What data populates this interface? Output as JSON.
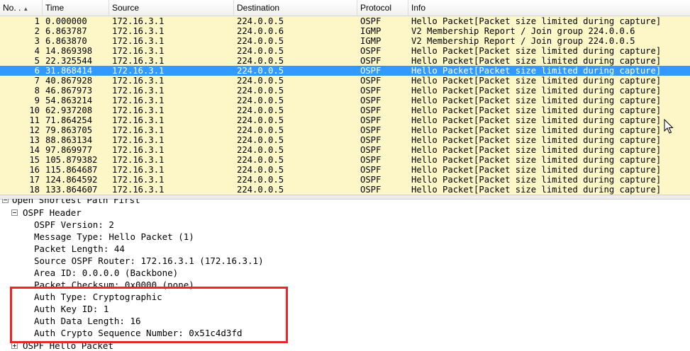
{
  "columns": [
    {
      "key": "no",
      "label": "No. ."
    },
    {
      "key": "time",
      "label": "Time"
    },
    {
      "key": "source",
      "label": "Source"
    },
    {
      "key": "destination",
      "label": "Destination"
    },
    {
      "key": "protocol",
      "label": "Protocol"
    },
    {
      "key": "info",
      "label": "Info"
    }
  ],
  "sort_indicator": "▲",
  "selected_row": 6,
  "colors": {
    "row_bg": "#fdf6c7",
    "selected_bg": "#3399ff",
    "highlight_box": "#e8262b"
  },
  "packets": [
    {
      "no": "1",
      "time": "0.000000",
      "source": "172.16.3.1",
      "destination": "224.0.0.5",
      "protocol": "OSPF",
      "info": "Hello Packet[Packet size limited during capture]"
    },
    {
      "no": "2",
      "time": "6.863787",
      "source": "172.16.3.1",
      "destination": "224.0.0.6",
      "protocol": "IGMP",
      "info": "V2 Membership Report / Join group 224.0.0.6"
    },
    {
      "no": "3",
      "time": "6.863870",
      "source": "172.16.3.1",
      "destination": "224.0.0.5",
      "protocol": "IGMP",
      "info": "V2 Membership Report / Join group 224.0.0.5"
    },
    {
      "no": "4",
      "time": "14.869398",
      "source": "172.16.3.1",
      "destination": "224.0.0.5",
      "protocol": "OSPF",
      "info": "Hello Packet[Packet size limited during capture]"
    },
    {
      "no": "5",
      "time": "22.325544",
      "source": "172.16.3.1",
      "destination": "224.0.0.5",
      "protocol": "OSPF",
      "info": "Hello Packet[Packet size limited during capture]"
    },
    {
      "no": "6",
      "time": "31.868414",
      "source": "172.16.3.1",
      "destination": "224.0.0.5",
      "protocol": "OSPF",
      "info": "Hello Packet[Packet size limited during capture]"
    },
    {
      "no": "7",
      "time": "40.867928",
      "source": "172.16.3.1",
      "destination": "224.0.0.5",
      "protocol": "OSPF",
      "info": "Hello Packet[Packet size limited during capture]"
    },
    {
      "no": "8",
      "time": "46.867973",
      "source": "172.16.3.1",
      "destination": "224.0.0.5",
      "protocol": "OSPF",
      "info": "Hello Packet[Packet size limited during capture]"
    },
    {
      "no": "9",
      "time": "54.863214",
      "source": "172.16.3.1",
      "destination": "224.0.0.5",
      "protocol": "OSPF",
      "info": "Hello Packet[Packet size limited during capture]"
    },
    {
      "no": "10",
      "time": "62.937208",
      "source": "172.16.3.1",
      "destination": "224.0.0.5",
      "protocol": "OSPF",
      "info": "Hello Packet[Packet size limited during capture]"
    },
    {
      "no": "11",
      "time": "71.864254",
      "source": "172.16.3.1",
      "destination": "224.0.0.5",
      "protocol": "OSPF",
      "info": "Hello Packet[Packet size limited during capture]"
    },
    {
      "no": "12",
      "time": "79.863705",
      "source": "172.16.3.1",
      "destination": "224.0.0.5",
      "protocol": "OSPF",
      "info": "Hello Packet[Packet size limited during capture]"
    },
    {
      "no": "13",
      "time": "88.863134",
      "source": "172.16.3.1",
      "destination": "224.0.0.5",
      "protocol": "OSPF",
      "info": "Hello Packet[Packet size limited during capture]"
    },
    {
      "no": "14",
      "time": "97.869977",
      "source": "172.16.3.1",
      "destination": "224.0.0.5",
      "protocol": "OSPF",
      "info": "Hello Packet[Packet size limited during capture]"
    },
    {
      "no": "15",
      "time": "105.879382",
      "source": "172.16.3.1",
      "destination": "224.0.0.5",
      "protocol": "OSPF",
      "info": "Hello Packet[Packet size limited during capture]"
    },
    {
      "no": "16",
      "time": "115.864687",
      "source": "172.16.3.1",
      "destination": "224.0.0.5",
      "protocol": "OSPF",
      "info": "Hello Packet[Packet size limited during capture]"
    },
    {
      "no": "17",
      "time": "124.864592",
      "source": "172.16.3.1",
      "destination": "224.0.0.5",
      "protocol": "OSPF",
      "info": "Hello Packet[Packet size limited during capture]"
    },
    {
      "no": "18",
      "time": "133.864607",
      "source": "172.16.3.1",
      "destination": "224.0.0.5",
      "protocol": "OSPF",
      "info": "Hello Packet[Packet size limited during capture]"
    }
  ],
  "details": {
    "ospf_top": "Open Shortest Path First",
    "ospf_header": "OSPF Header",
    "fields": [
      "OSPF Version: 2",
      "Message Type: Hello Packet (1)",
      "Packet Length: 44",
      "Source OSPF Router: 172.16.3.1 (172.16.3.1)",
      "Area ID: 0.0.0.0 (Backbone)",
      "Packet Checksum: 0x0000 (none)",
      "Auth Type: Cryptographic",
      "Auth Key ID: 1",
      "Auth Data Length: 16",
      "Auth Crypto Sequence Number: 0x51c4d3fd"
    ],
    "hello_packet": "OSPF Hello Packet"
  }
}
